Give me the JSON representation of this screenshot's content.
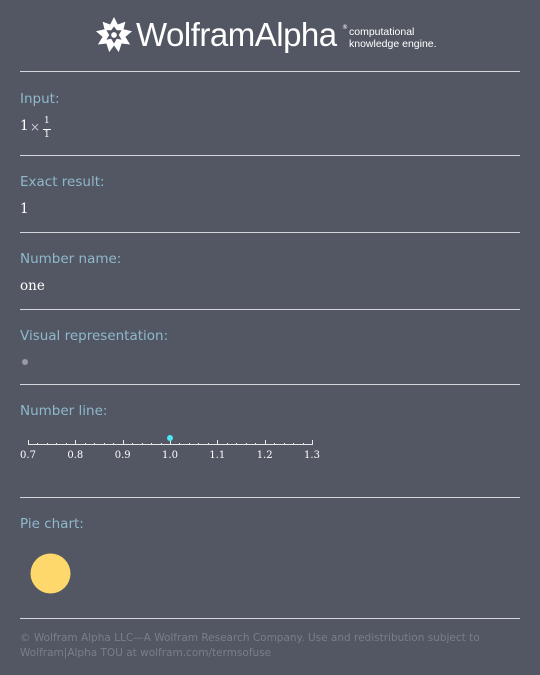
{
  "header": {
    "brand": "WolframAlpha",
    "registered": "®",
    "tagline_line1": "computational",
    "tagline_line2": "knowledge engine."
  },
  "pods": {
    "input": {
      "title": "Input:",
      "lead": "1",
      "operator": "×",
      "numerator": "1",
      "denominator": "1"
    },
    "exact": {
      "title": "Exact result:",
      "value": "1"
    },
    "name": {
      "title": "Number name:",
      "value": "one"
    },
    "visual": {
      "title": "Visual representation:",
      "dot_count": 1
    },
    "number_line": {
      "title": "Number line:",
      "point_value": 1.0,
      "point_color": "#4ee6f5",
      "ticks": [
        "0.7",
        "0.8",
        "0.9",
        "1.0",
        "1.1",
        "1.2",
        "1.3"
      ],
      "range": [
        0.7,
        1.3
      ]
    },
    "pie": {
      "title": "Pie chart:",
      "fill_fraction": 1,
      "color": "#ffd86b"
    }
  },
  "footer": {
    "line1": "© Wolfram Alpha LLC—A Wolfram Research Company. Use and redistribution subject to",
    "line2": "Wolfram|Alpha TOU at wolfram.com/termsofuse"
  },
  "colors": {
    "background": "#535763",
    "pod_title": "#8fb8cc",
    "footer_text": "#7a7e8a"
  }
}
